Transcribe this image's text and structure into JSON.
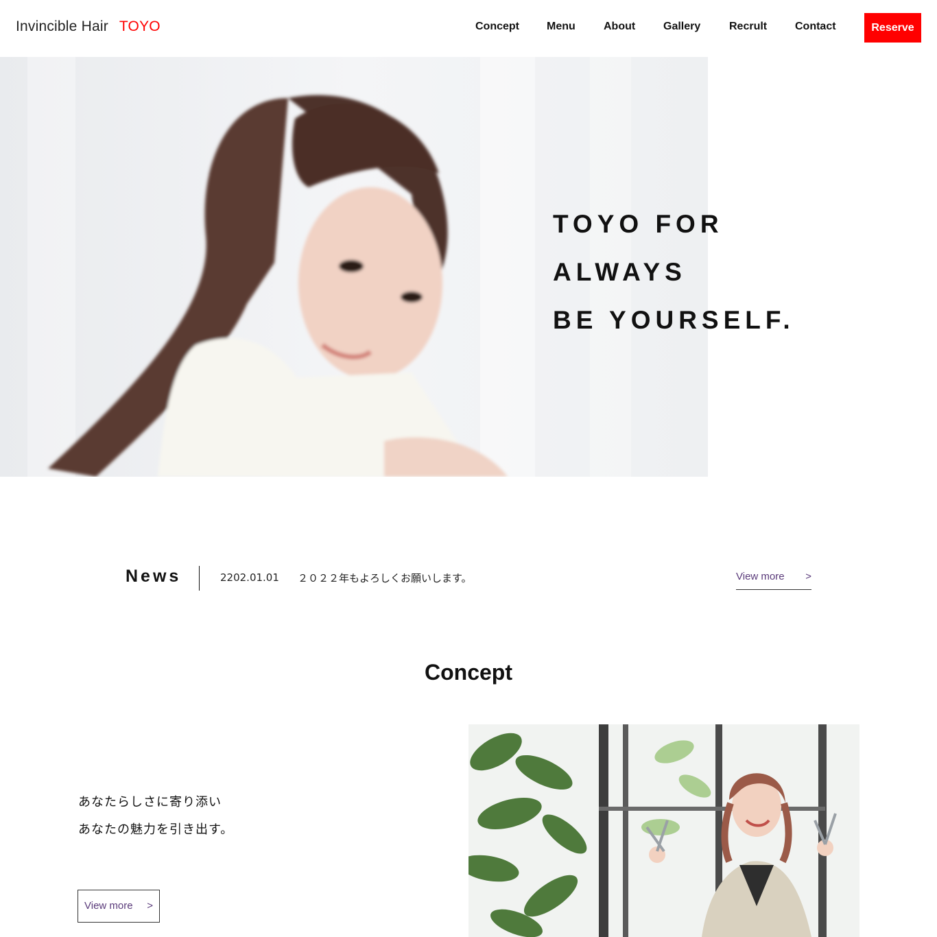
{
  "header": {
    "logo_text": "Invincible Hair",
    "logo_accent": "TOYO",
    "nav": [
      "Concept",
      "Menu",
      "About",
      "Gallery",
      "Recrult",
      "Contact"
    ],
    "reserve_label": "Reserve"
  },
  "hero": {
    "heading_lines": [
      "TOYO FOR",
      "ALWAYS",
      "BE YOURSELF."
    ]
  },
  "news": {
    "title": "News",
    "date": "2202.01.01",
    "text": "２０２２年もよろしくお願いします。",
    "more_label": "View more",
    "more_arrow": ">"
  },
  "concept": {
    "title": "Concept",
    "lines": [
      "あなたらしさに寄り添い",
      "あなたの魅力を引き出す。"
    ],
    "more_label": "View more",
    "more_arrow": ">"
  },
  "colors": {
    "accent": "#ff0000",
    "link": "#5a3a7a",
    "text": "#111111"
  }
}
